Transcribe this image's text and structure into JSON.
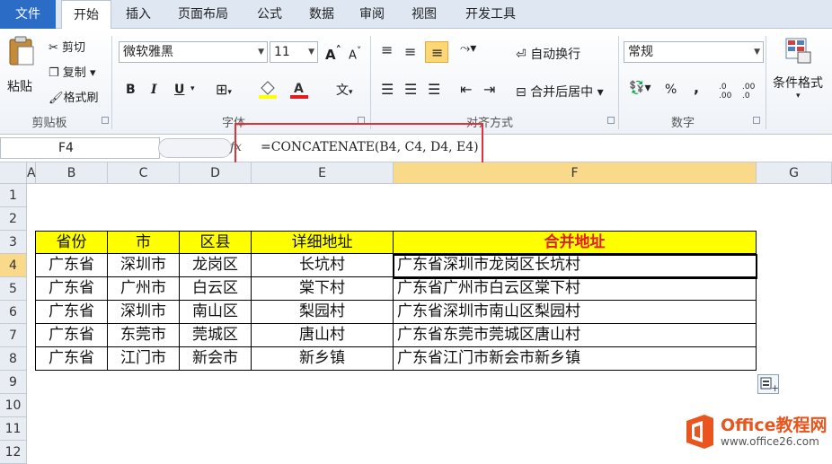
{
  "tabs": [
    "文件",
    "开始",
    "插入",
    "页面布局",
    "公式",
    "数据",
    "审阅",
    "视图",
    "开发工具"
  ],
  "clipboard": {
    "paste": "粘贴",
    "cut": "剪切",
    "copy": "复制",
    "format_painter": "格式刷",
    "group": "剪贴板"
  },
  "font": {
    "name": "微软雅黑",
    "size": "11",
    "group": "字体",
    "bold": "B",
    "italic": "I",
    "underline": "U",
    "wen": "文"
  },
  "align": {
    "wrap": "自动换行",
    "merge": "合并后居中",
    "group": "对齐方式"
  },
  "number": {
    "format": "常规",
    "group": "数字",
    "percent": "%",
    "comma": ",",
    "inc": ".0 .00",
    "dec": ".00 .0"
  },
  "styles": {
    "cond": "条件格式"
  },
  "namebox": "F4",
  "formula": "=CONCATENATE(B4, C4, D4, E4)",
  "fx": "fx",
  "columns": [
    "A",
    "B",
    "C",
    "D",
    "E",
    "F",
    "G"
  ],
  "rows": [
    "1",
    "2",
    "3",
    "4",
    "5",
    "6",
    "7",
    "8",
    "9",
    "10",
    "11",
    "12"
  ],
  "table": {
    "headers": [
      "省份",
      "市",
      "区县",
      "详细地址",
      "合并地址"
    ],
    "data": [
      [
        "广东省",
        "深圳市",
        "龙岗区",
        "长坑村",
        "广东省深圳市龙岗区长坑村"
      ],
      [
        "广东省",
        "广州市",
        "白云区",
        "棠下村",
        "广东省广州市白云区棠下村"
      ],
      [
        "广东省",
        "深圳市",
        "南山区",
        "梨园村",
        "广东省深圳市南山区梨园村"
      ],
      [
        "广东省",
        "东莞市",
        "莞城区",
        "唐山村",
        "广东省东莞市莞城区唐山村"
      ],
      [
        "广东省",
        "江门市",
        "新会市",
        "新乡镇",
        "广东省江门市新会市新乡镇"
      ]
    ]
  },
  "watermark": {
    "brand": "Office教程网",
    "url": "www.office26.com"
  },
  "colors": {
    "accent": "#2b6cc7",
    "header_fill": "#ffff00",
    "header_red": "#e31b23",
    "highlight_box": "#e0303a",
    "selection": "#f9d98a"
  }
}
